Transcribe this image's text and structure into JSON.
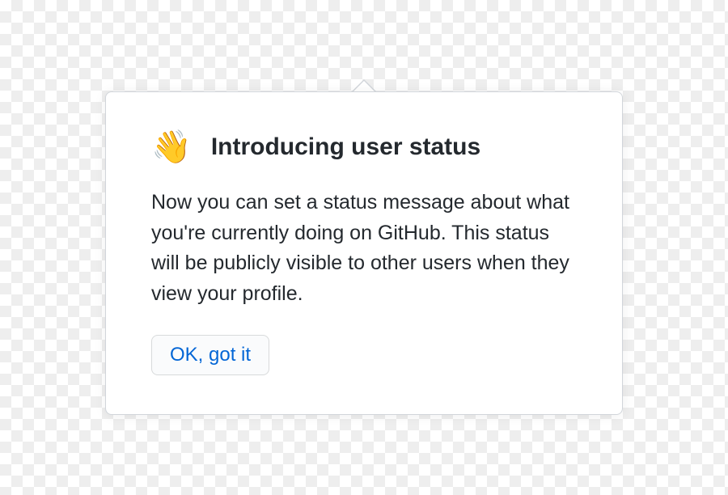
{
  "popover": {
    "icon": "👋",
    "title": "Introducing user status",
    "body": "Now you can set a status message about what you're currently doing on GitHub. This status will be publicly visible to other users when they view your profile.",
    "button_label": "OK, got it"
  }
}
